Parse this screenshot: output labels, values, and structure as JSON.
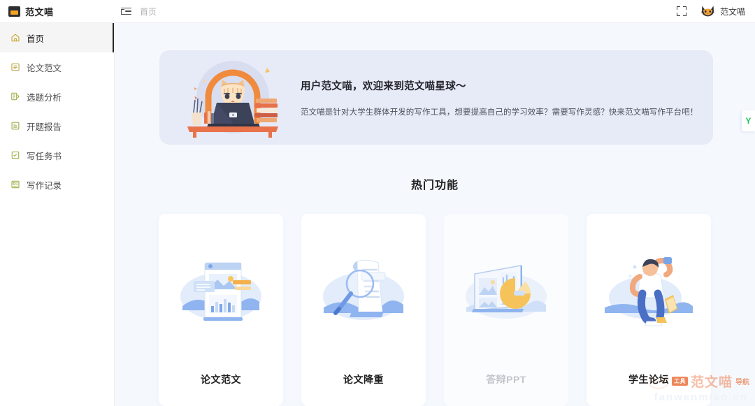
{
  "app": {
    "brand_name": "范文喵",
    "brand_logo_icon": "cat-logo-icon"
  },
  "topbar": {
    "collapse_icon": "menu-collapse-icon",
    "breadcrumb": "首页",
    "fullscreen_icon": "fullscreen-icon",
    "avatar_icon": "cat-avatar-icon",
    "user_name": "范文喵"
  },
  "sidebar": {
    "items": [
      {
        "label": "首页",
        "icon": "home-icon",
        "active": true
      },
      {
        "label": "论文范文",
        "icon": "document-icon",
        "active": false
      },
      {
        "label": "选题分析",
        "icon": "analysis-icon",
        "active": false
      },
      {
        "label": "开题报告",
        "icon": "report-icon",
        "active": false
      },
      {
        "label": "写任务书",
        "icon": "task-book-icon",
        "active": false
      },
      {
        "label": "写作记录",
        "icon": "writing-record-icon",
        "active": false
      }
    ]
  },
  "main": {
    "banner": {
      "illustration_icon": "cat-laptop-illustration",
      "title": "用户范文喵，欢迎来到范文喵星球～",
      "subtitle": "范文喵是针对大学生群体开发的写作工具，想要提高自己的学习效率？需要写作灵感？快来范文喵写作平台吧！",
      "background_color": "#e7eaf7"
    },
    "section_title": "热门功能",
    "cards": [
      {
        "label": "论文范文",
        "icon": "document-chart-illustration",
        "disabled": false
      },
      {
        "label": "论文降重",
        "icon": "magnifier-paper-illustration",
        "disabled": false
      },
      {
        "label": "答辩PPT",
        "icon": "presentation-illustration",
        "disabled": true
      },
      {
        "label": "学生论坛",
        "icon": "student-illustration",
        "disabled": false
      }
    ],
    "side_widget_label": "Y"
  },
  "watermark": {
    "cat_icon": "watermark-cat-icon",
    "badge": "工具",
    "text": "范文喵",
    "nav": "导航",
    "url": "fanwenmiao.cn"
  },
  "colors": {
    "accent_orange": "#e8581c",
    "banner_bg": "#e7eaf7",
    "main_bg": "#f5f9fe",
    "sidebar_active_bg": "#f5f5f5",
    "widget_green": "#22c55e"
  }
}
